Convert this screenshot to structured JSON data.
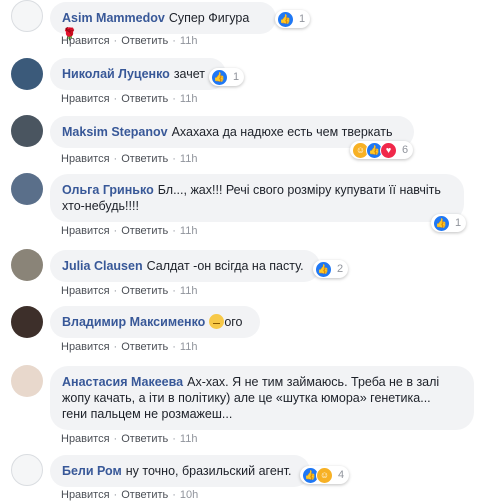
{
  "actions": {
    "like": "Нравится",
    "reply": "Ответить",
    "time": "11h",
    "time_last": "10h",
    "sep": "·"
  },
  "comments": [
    {
      "author": "Asim Mammedov",
      "text": "Супер Фигура",
      "emoji_after": "🌹",
      "reactions": [
        "like"
      ],
      "count": "1"
    },
    {
      "author": "Николай Луценко",
      "text": "зачет",
      "reactions": [
        "like"
      ],
      "count": "1"
    },
    {
      "author": "Maksim Stepanov",
      "text": "Ахахаха да надюхе есть чем тверкать",
      "reactions": [
        "haha",
        "like",
        "love"
      ],
      "count": "6"
    },
    {
      "author": "Ольга Гринько",
      "text_line1": "Бл..., жах!!! Речі свого розміру купувати її навчіть",
      "text_line2": "хто-небудь!!!!",
      "reactions": [
        "like"
      ],
      "count": "1"
    },
    {
      "author": "Julia Clausen",
      "text": "Салдат -он всігда на пасту.",
      "reactions": [
        "like"
      ],
      "count": "2"
    },
    {
      "author": "Владимир Максименко",
      "text": "ого",
      "emoji_before": "😐"
    },
    {
      "author": "Анастасия Макеева",
      "text_line1": "Ах-хах. Я не тим займаюсь. Треба не в залі",
      "text_line2": "жопу качать, а іти в політику) але це «шутка юмора» генетика...",
      "text_line3": "гени пальцем не розмажеш...",
      "reactions": []
    },
    {
      "author": "Бели Ром",
      "text": "ну точно, бразильский агент.",
      "reactions": [
        "like",
        "haha"
      ],
      "count": "4"
    }
  ],
  "colors": {
    "author": "#385898",
    "bubble": "#f2f3f5",
    "like": "#2078f4",
    "haha": "#f7b125",
    "love": "#f0284a"
  }
}
